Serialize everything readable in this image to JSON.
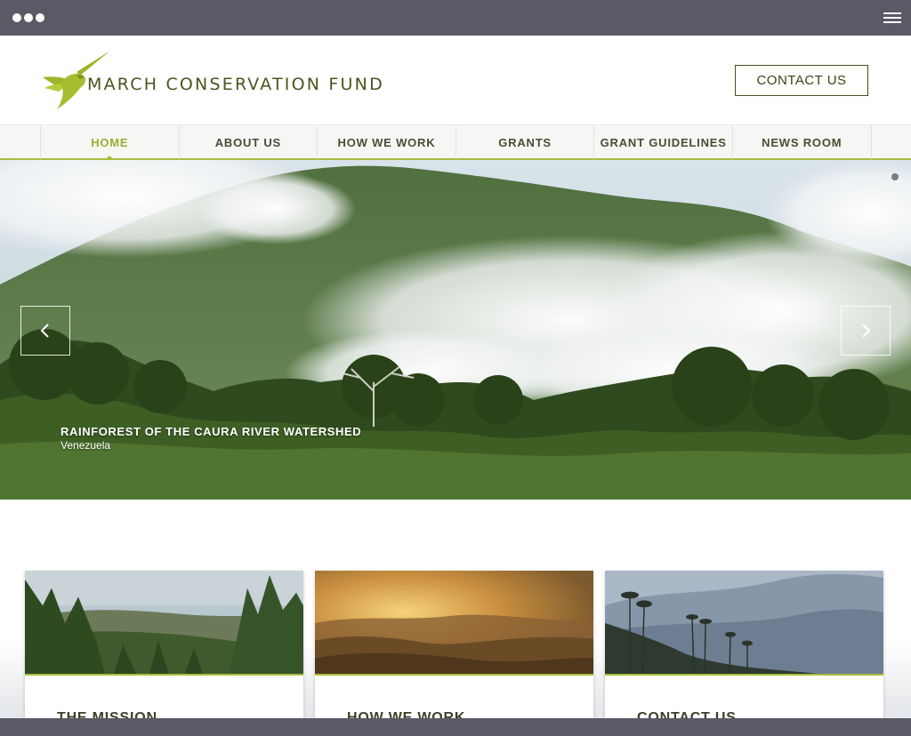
{
  "browser": {
    "menu_icon": "hamburger-icon",
    "window_dots_icon": "window-dots-icon"
  },
  "header": {
    "logo_text": "MARCH CONSERVATION FUND",
    "logo_icon": "hummingbird-icon",
    "contact_button": "CONTACT US"
  },
  "nav": {
    "items": [
      {
        "label": "HOME",
        "active": true
      },
      {
        "label": "ABOUT US",
        "active": false
      },
      {
        "label": "HOW WE WORK",
        "active": false
      },
      {
        "label": "GRANTS",
        "active": false
      },
      {
        "label": "GRANT GUIDELINES",
        "active": false
      },
      {
        "label": "NEWS ROOM",
        "active": false
      }
    ]
  },
  "hero": {
    "caption_title": "RAINFOREST OF THE CAURA RIVER WATERSHED",
    "caption_subtitle": "Venezuela",
    "prev_icon": "chevron-left-icon",
    "next_icon": "chevron-right-icon"
  },
  "cards": [
    {
      "title": "THE MISSION"
    },
    {
      "title": "HOW WE WORK"
    },
    {
      "title": "CONTACT US"
    }
  ],
  "colors": {
    "accent": "#a9bd3b",
    "brand": "#4e5320",
    "frame": "#5b5966"
  }
}
